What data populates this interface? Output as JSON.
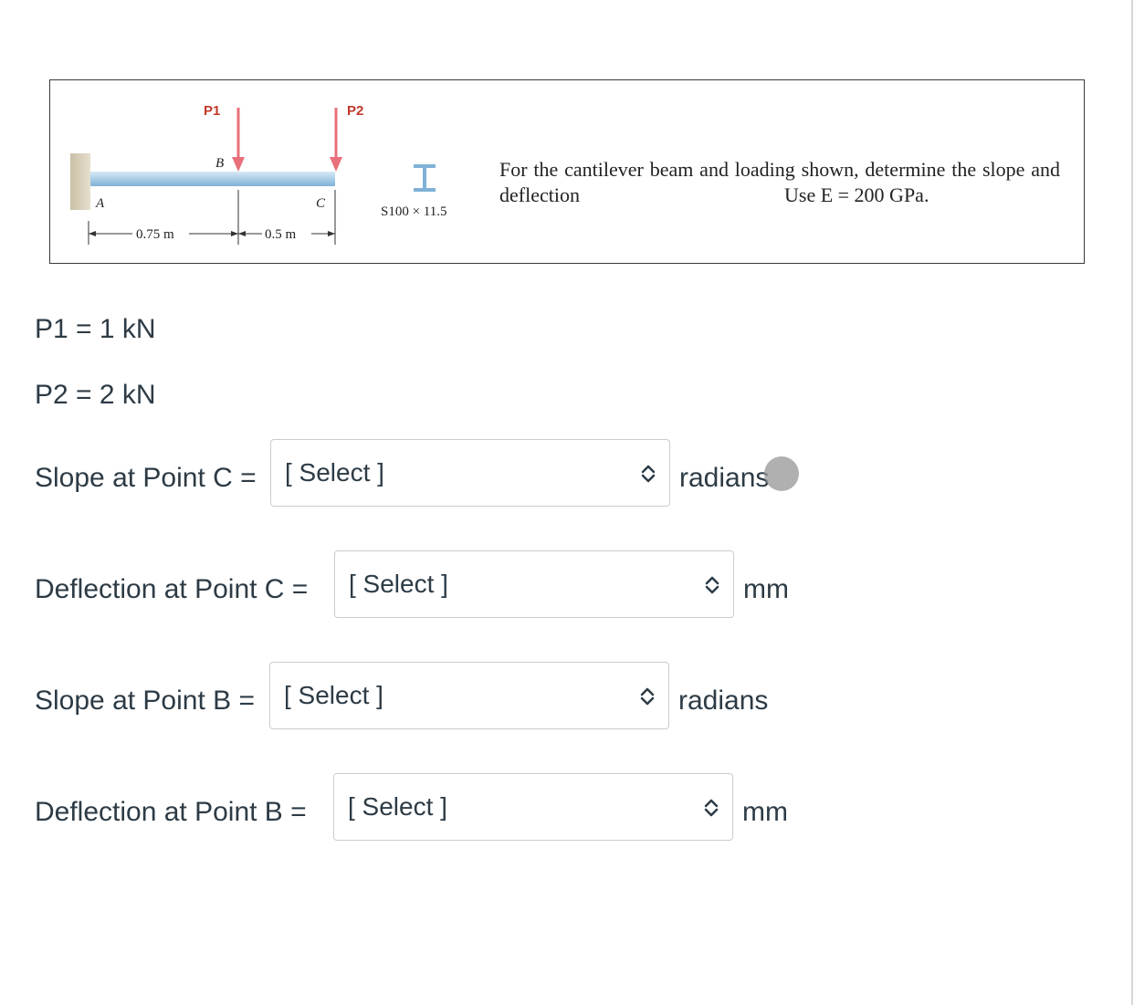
{
  "figure": {
    "load_labels": {
      "p1": "P1",
      "p2": "P2"
    },
    "point_labels": {
      "a": "A",
      "b": "B",
      "c": "C"
    },
    "dimensions": {
      "ab": "0.75 m",
      "bc": "0.5 m"
    },
    "section_label": "S100 × 11.5",
    "problem_text": "For the cantilever beam and loading shown, determine the slope and deflection",
    "use_e_text": "Use E = 200 GPa."
  },
  "given": {
    "p1": "P1 = 1 kN",
    "p2": "P2 = 2 kN"
  },
  "questions": [
    {
      "label": "Slope at Point C =",
      "selected": "[ Select ]",
      "unit": "radians"
    },
    {
      "label": "Deflection at Point C =",
      "selected": "[ Select ]",
      "unit": "mm"
    },
    {
      "label": "Slope at Point B =",
      "selected": "[ Select ]",
      "unit": "radians"
    },
    {
      "label": "Deflection at Point B =",
      "selected": "[ Select ]",
      "unit": "mm"
    }
  ],
  "colors": {
    "load_arrow": "#e8707a",
    "beam": "#a9cde6",
    "wall": "#d8cfba"
  }
}
